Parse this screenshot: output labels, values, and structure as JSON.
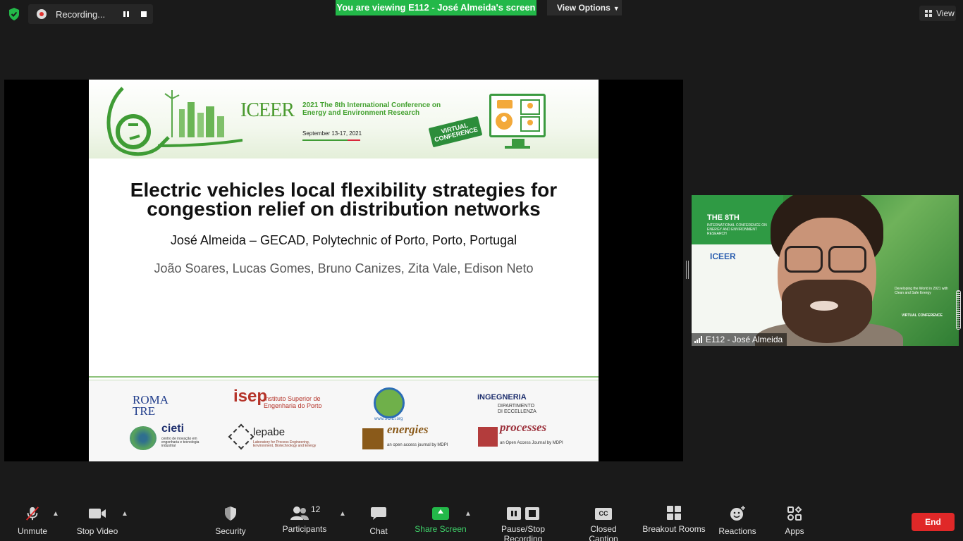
{
  "topbar": {
    "recording_label": "Recording...",
    "viewing_banner": "You are viewing E112 - José Almeida's screen",
    "view_options_label": "View Options",
    "view_label": "View"
  },
  "slide": {
    "iceer_word": "ICEER",
    "conference_line1": "2021 The 8th International Conference on",
    "conference_line2": "Energy and Environment Research",
    "conference_date": "September 13-17, 2021",
    "virtual_badge_line1": "VIRTUAL",
    "virtual_badge_line2": "CONFERENCE",
    "title_line1": "Electric vehicles local flexibility strategies for",
    "title_line2": "congestion relief on distribution networks",
    "author": "José Almeida – GECAD, Polytechnic of Porto, Porto, Portugal",
    "coauthors": "João Soares, Lucas Gomes, Bruno Canizes, Zita Vale, Edison Neto",
    "logos": {
      "roma_line1": "ROMA",
      "roma_line2": "TRE",
      "isep": "isep",
      "isep_sub": "Instituto Superior de Engenharia do Porto",
      "sciei_sub": "www.SCIEI.org",
      "ingegneria": "iNGEGNERIA",
      "ingegneria_sub": "DIPARTIMENTO DI ECCELLENZA",
      "cieti": "cieti",
      "cieti_sub": "centro de inovação em engenharia e tecnologia industrial",
      "lepabe": "lepabe",
      "lepabe_sub": "Laboratory for Process Engineering, Environment, Biotechnology and Energy",
      "energies": "energies",
      "energies_sub": "an open access journal by MDPI",
      "processes": "processes",
      "processes_sub": "an Open Access Journal by MDPI"
    }
  },
  "video": {
    "backdrop_title": "THE 8TH",
    "backdrop_sub": "INTERNATIONAL CONFERENCE ON ENERGY AND ENVIRONMENT RESEARCH",
    "backdrop_iceer": "ICEER",
    "backdrop_right": "Developing the World in 2021 with Clean and Safe Energy",
    "backdrop_virtual": "VIRTUAL CONFERENCE",
    "name": "E112 - José Almeida"
  },
  "toolbar": {
    "unmute": "Unmute",
    "stop_video": "Stop Video",
    "security": "Security",
    "participants": "Participants",
    "participants_count": "12",
    "chat": "Chat",
    "share_screen": "Share Screen",
    "pause_stop_recording": "Pause/Stop Recording",
    "closed_caption": "Closed Caption",
    "cc_icon_text": "CC",
    "breakout_rooms": "Breakout Rooms",
    "reactions": "Reactions",
    "apps": "Apps",
    "end": "End"
  },
  "colors": {
    "banner_green": "#23b849",
    "end_red": "#e02828",
    "background": "#1a1a1a"
  }
}
